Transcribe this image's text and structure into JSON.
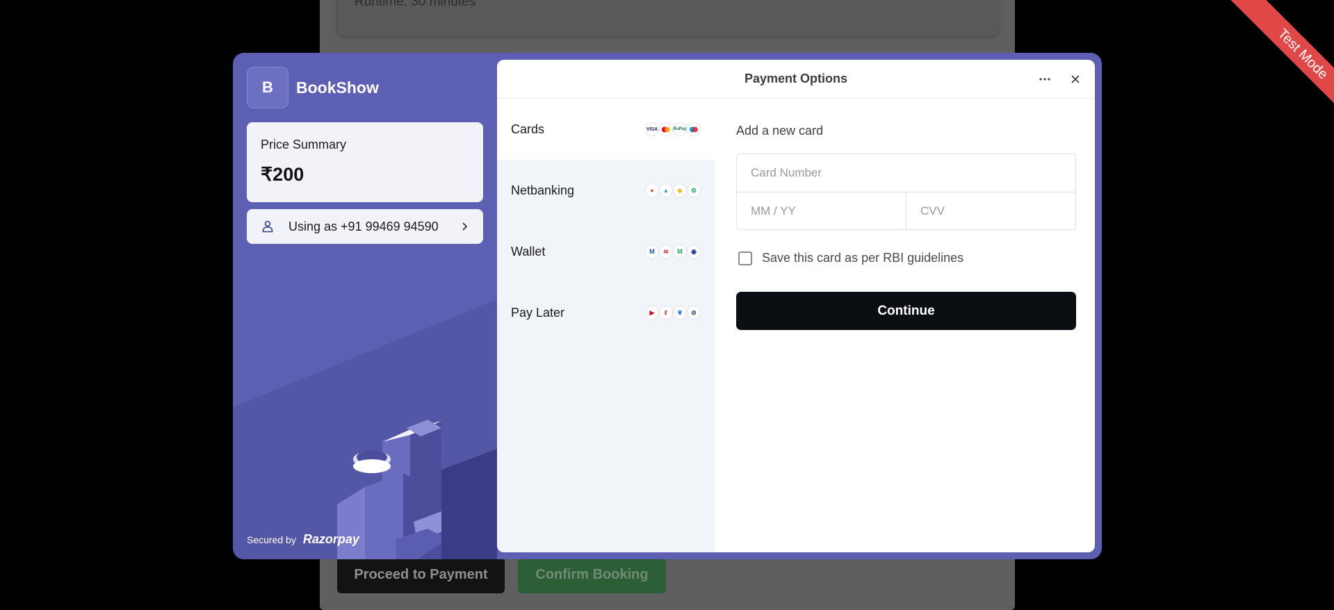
{
  "background_page": {
    "runtime_text": "Runtime: 30 minutes",
    "proceed_label": "Proceed to Payment",
    "confirm_label": "Confirm Booking"
  },
  "ribbon": {
    "label": "Test Mode",
    "color": "#e04848"
  },
  "merchant": {
    "logo_letter": "B",
    "name": "BookShow",
    "brand_color": "#5d5fb3"
  },
  "price_summary": {
    "label": "Price Summary",
    "amount": "₹200"
  },
  "user": {
    "label": "Using as +91 99469 94590",
    "icon": "person-icon"
  },
  "footer": {
    "secured_by": "Secured by",
    "provider": "Razorpay"
  },
  "panel": {
    "title": "Payment Options",
    "more_icon": "more-horizontal-icon",
    "close_icon": "close-icon"
  },
  "methods": [
    {
      "label": "Cards",
      "active": true
    },
    {
      "label": "Netbanking",
      "active": false
    },
    {
      "label": "Wallet",
      "active": false
    },
    {
      "label": "Pay Later",
      "active": false
    }
  ],
  "card_form": {
    "title": "Add a new card",
    "card_number_placeholder": "Card Number",
    "expiry_placeholder": "MM / YY",
    "cvv_placeholder": "CVV",
    "save_label": "Save this card as per RBI guidelines",
    "save_checked": false,
    "continue_label": "Continue"
  }
}
